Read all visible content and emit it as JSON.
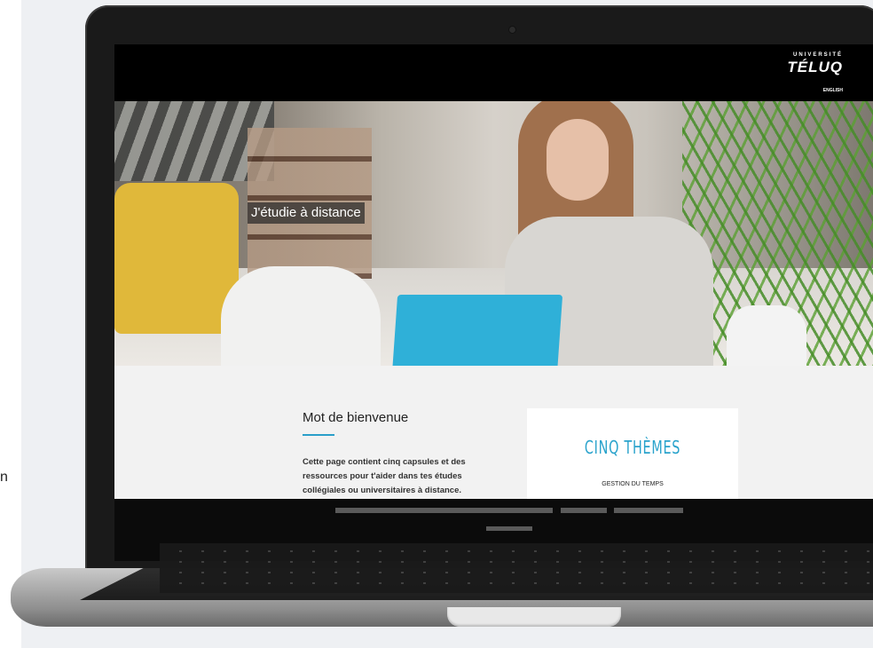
{
  "site": {
    "logo_top": "UNIVERSITÉ",
    "logo_main": "TÉLUQ",
    "lang_link": "ENGLISH"
  },
  "hero": {
    "tag": "J'étudie à distance"
  },
  "welcome": {
    "title": "Mot de bienvenue",
    "text": "Cette page contient cinq capsules et des ressources pour t'aider dans tes études collégiales ou universitaires à distance."
  },
  "themes": {
    "title": "CINQ THÈMES",
    "items": [
      "GESTION DU TEMPS"
    ]
  },
  "side": {
    "partial_char": "n"
  },
  "colors": {
    "accent": "#2aa3cc",
    "header_bg": "#000000",
    "page_bg": "#f2f2f2"
  }
}
